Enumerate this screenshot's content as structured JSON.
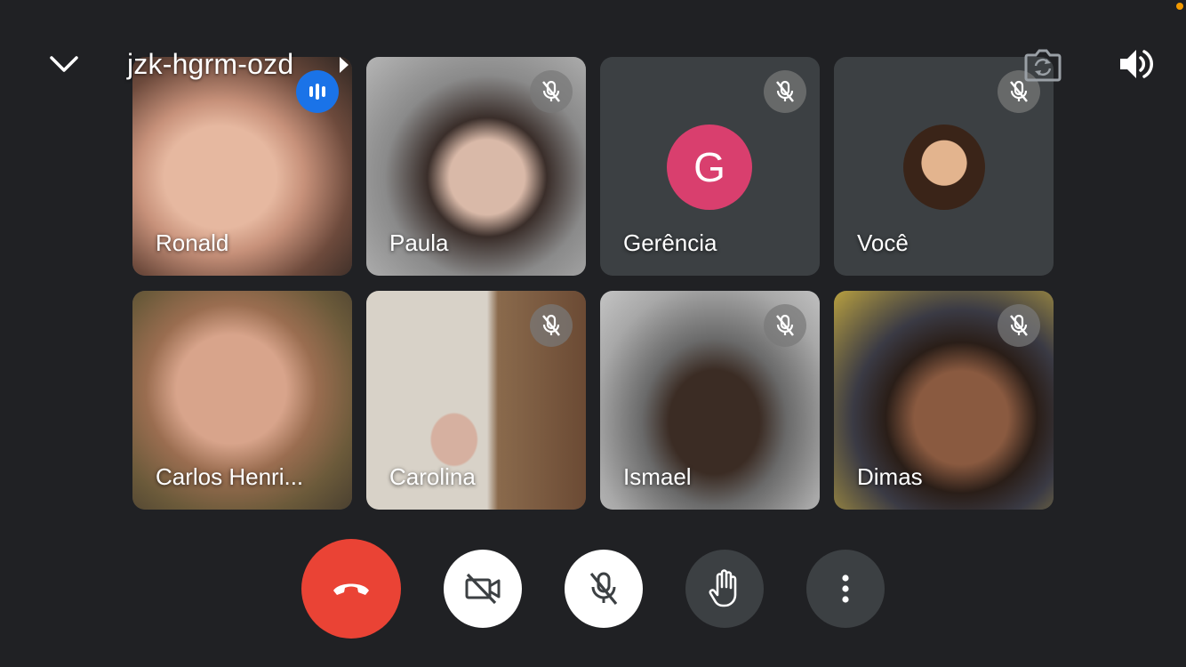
{
  "meeting": {
    "code": "jzk-hgrm-ozd"
  },
  "colors": {
    "background": "#202124",
    "tile": "#3c4043",
    "end_call": "#ea4335",
    "speaking": "#1a73e8",
    "avatar_g": "#d93f6e",
    "recording_dot": "#f29900"
  },
  "participants": [
    {
      "name": "Ronald",
      "status": "speaking"
    },
    {
      "name": "Paula",
      "status": "muted"
    },
    {
      "name": "Gerência",
      "status": "muted",
      "avatar_letter": "G"
    },
    {
      "name": "Você",
      "status": "muted"
    },
    {
      "name": "Carlos Henri...",
      "status": "unmuted"
    },
    {
      "name": "Carolina",
      "status": "muted"
    },
    {
      "name": "Ismael",
      "status": "muted"
    },
    {
      "name": "Dimas",
      "status": "muted"
    }
  ],
  "controls": {
    "end_call_icon": "phone-hangup-icon",
    "camera_icon": "camera-off-icon",
    "mic_icon": "mic-off-icon",
    "hand_icon": "raise-hand-icon",
    "more_icon": "more-vertical-icon"
  }
}
